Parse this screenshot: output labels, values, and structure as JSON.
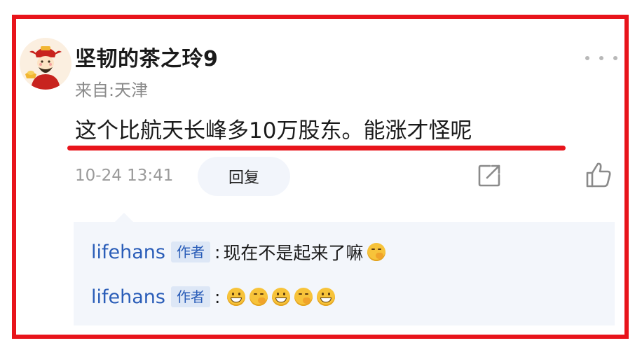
{
  "comment": {
    "username": "坚韧的茶之玲9",
    "location": "来自:天津",
    "text": "这个比航天长峰多10万股东。能涨才怪呢",
    "timestamp": "10-24 13:41",
    "reply_label": "回复",
    "avatar_icon": "fortune-god-avatar",
    "share_icon": "share-icon",
    "like_icon": "thumbs-up-icon",
    "more_icon": "more-dots-icon"
  },
  "replies": [
    {
      "user": "lifehans",
      "badge": "作者",
      "colon": ":",
      "text": "现在不是起来了嘛",
      "emojis": [
        "giggle"
      ]
    },
    {
      "user": "lifehans",
      "badge": "作者",
      "colon": ":",
      "text": "",
      "emojis": [
        "grin",
        "giggle",
        "grin",
        "giggle",
        "grin"
      ]
    }
  ],
  "colors": {
    "highlight_border": "#e8141b",
    "link_blue": "#2a5db8",
    "reply_bg": "#f3f6fb"
  }
}
